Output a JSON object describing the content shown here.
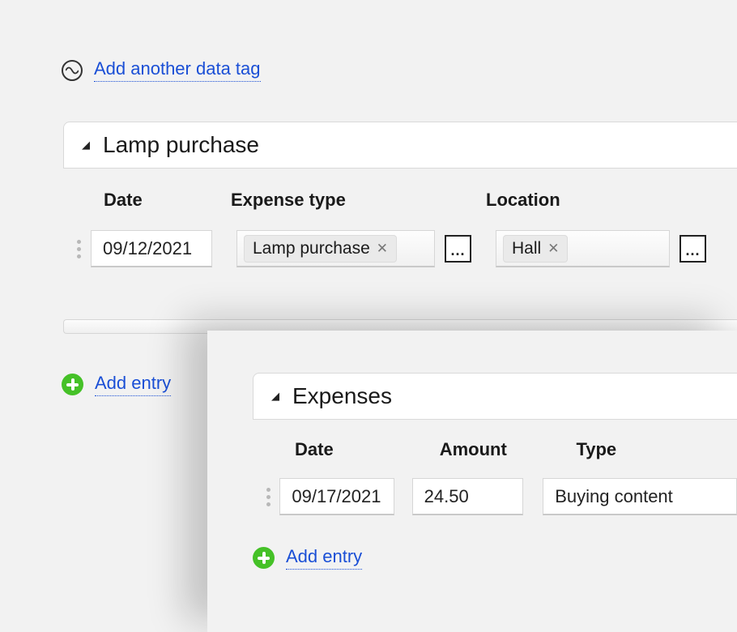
{
  "top_link": {
    "label": "Add another data tag"
  },
  "panel1": {
    "title": "Lamp purchase",
    "columns": {
      "date": "Date",
      "expense_type": "Expense type",
      "location": "Location"
    },
    "row": {
      "date": "09/12/2021",
      "expense_type_chip": "Lamp purchase",
      "location_chip": "Hall",
      "ellipsis": "..."
    },
    "add_entry_label": "Add entry"
  },
  "panel2": {
    "title": "Expenses",
    "columns": {
      "date": "Date",
      "amount": "Amount",
      "type": "Type"
    },
    "row": {
      "date": "09/17/2021",
      "amount": "24.50",
      "type": "Buying content"
    },
    "add_entry_label": "Add entry"
  }
}
